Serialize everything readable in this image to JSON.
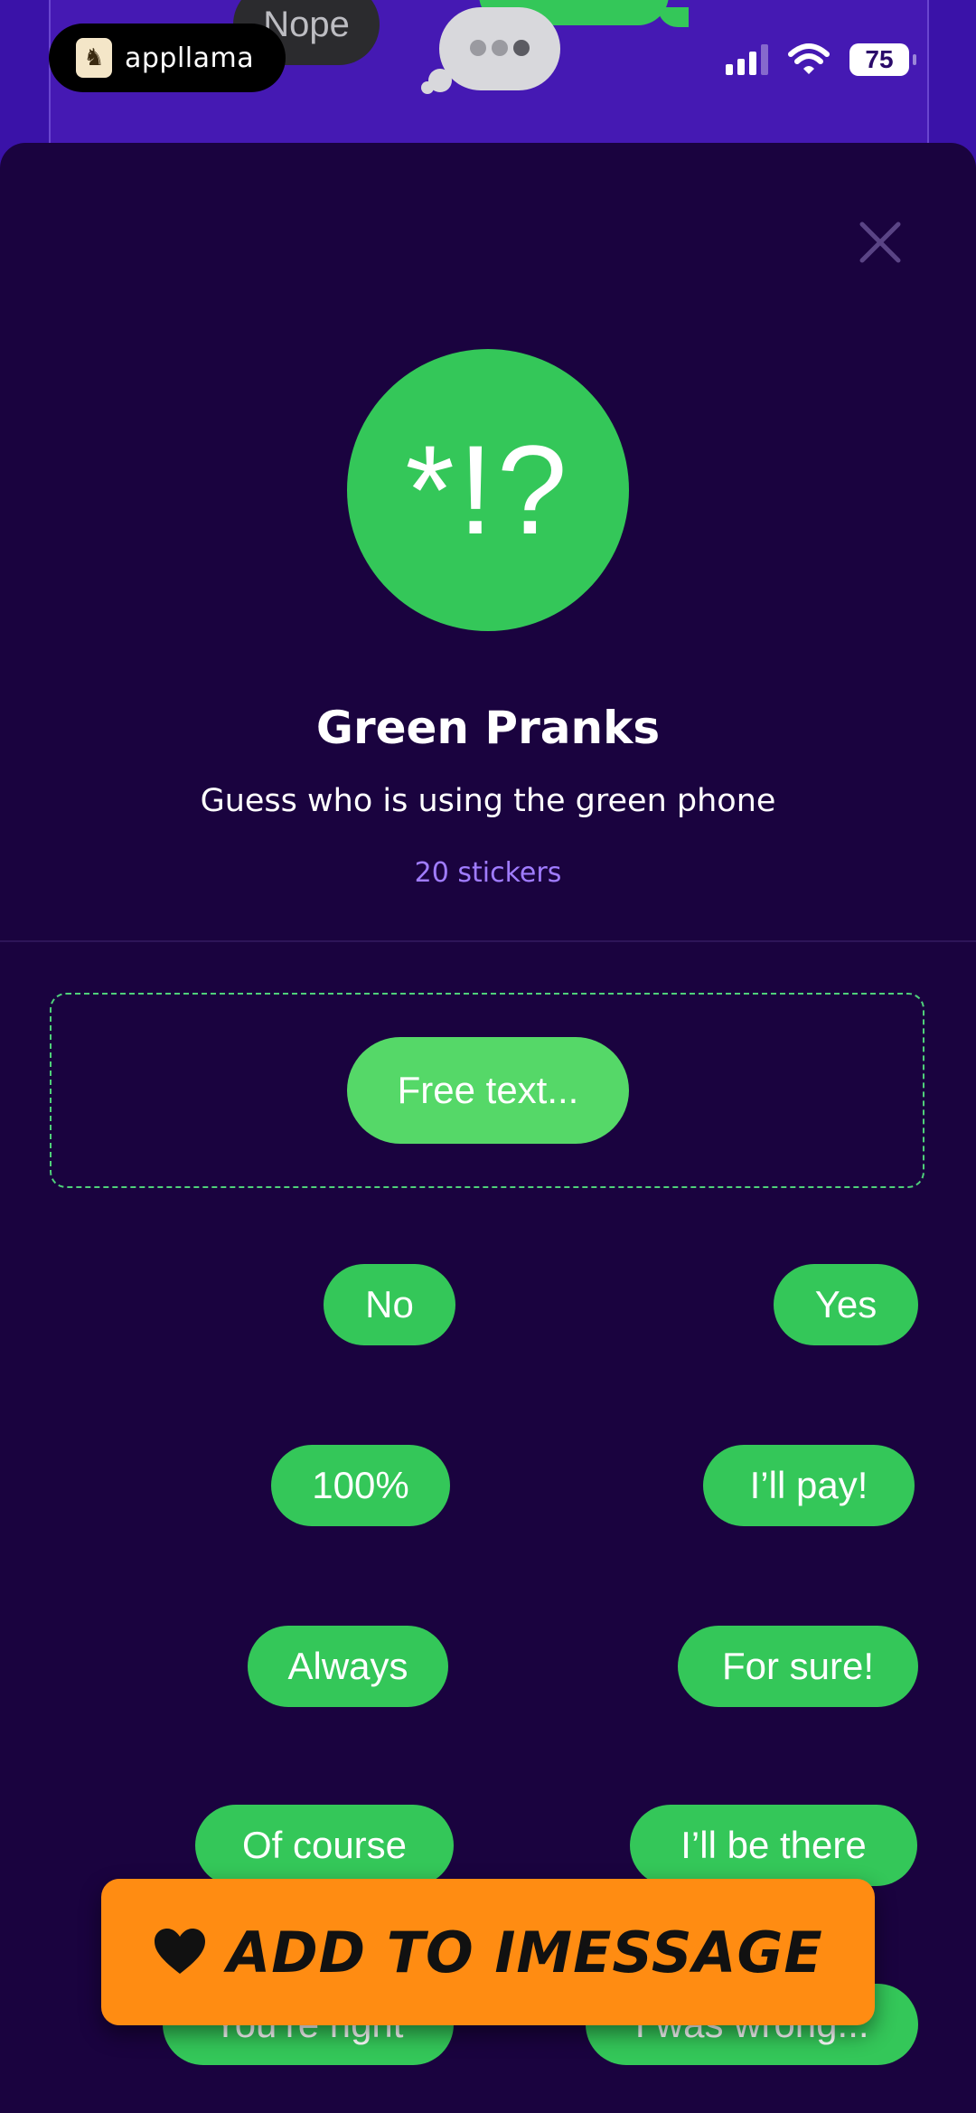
{
  "background_preview": {
    "nope_bubble_text": "Nope"
  },
  "overlay_badge": {
    "brand_name": "appllama",
    "logo_icon": "llama-icon"
  },
  "status_bar": {
    "signal_icon": "cellular-signal-icon",
    "wifi_icon": "wifi-icon",
    "battery_level": "75"
  },
  "sheet": {
    "close_icon": "close-icon",
    "pack_icon_text": "*!?",
    "title": "Green Pranks",
    "subtitle": "Guess who is using the green phone",
    "sticker_count": "20 stickers"
  },
  "free_text_sticker": {
    "label": "Free text..."
  },
  "stickers": [
    {
      "label": "No"
    },
    {
      "label": "Yes"
    },
    {
      "label": "100%"
    },
    {
      "label": "I’ll pay!"
    },
    {
      "label": "Always"
    },
    {
      "label": "For sure!"
    },
    {
      "label": "Of course"
    },
    {
      "label": "I’ll be there"
    },
    {
      "label": "You’re right"
    },
    {
      "label": "I was wrong..."
    }
  ],
  "cta": {
    "label": "ADD TO IMESSAGE",
    "icon": "heart-icon"
  },
  "colors": {
    "background": "#1a033f",
    "sticker_green": "#34c759",
    "accent_purple": "#a07cff",
    "cta_orange": "#ff8c12"
  }
}
